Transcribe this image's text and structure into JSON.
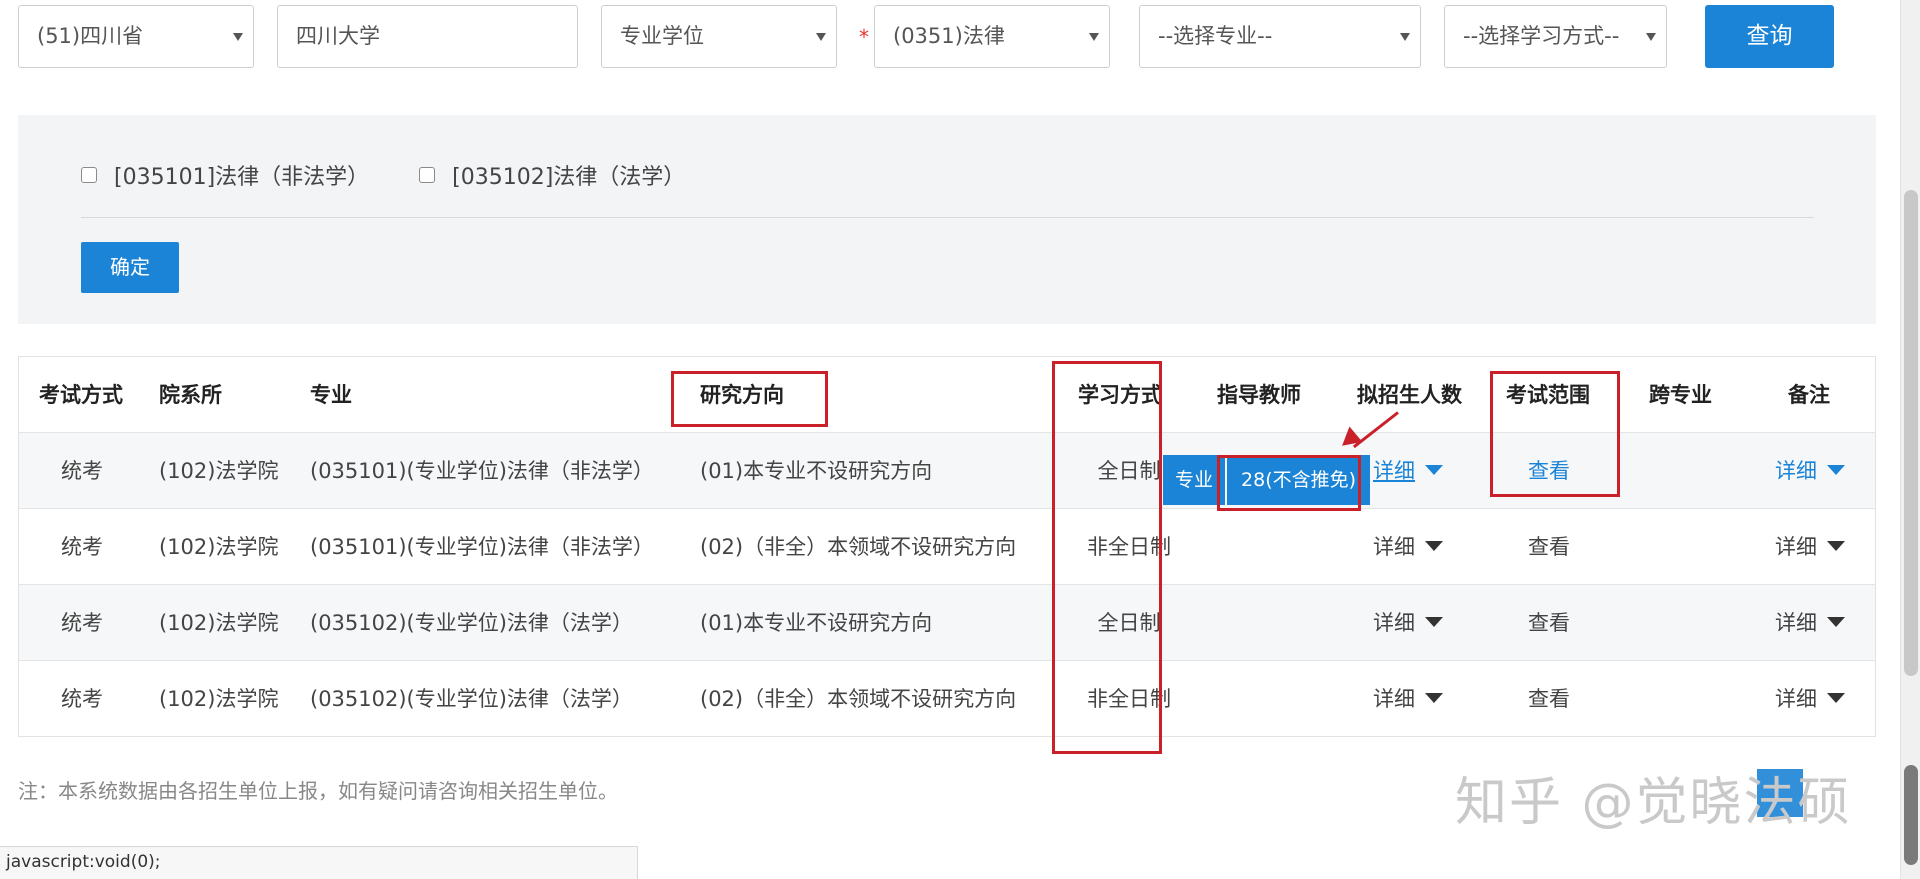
{
  "filters": {
    "province": "(51)四川省",
    "school": "四川大学",
    "degree_type": "专业学位",
    "required_mark": "*",
    "discipline": "(0351)法律",
    "major_placeholder": "--选择专业--",
    "study_mode_placeholder": "--选择学习方式--",
    "query_label": "查询"
  },
  "majors_panel": {
    "options": [
      {
        "label": "[035101]法律（非法学）",
        "checked": false
      },
      {
        "label": "[035102]法律（法学）",
        "checked": false
      }
    ],
    "confirm_label": "确定"
  },
  "table": {
    "headers": {
      "exam_type": "考试方式",
      "department": "院系所",
      "major": "专业",
      "research_direction": "研究方向",
      "study_mode": "学习方式",
      "advisor": "指导教师",
      "planned_enrollment": "拟招生人数",
      "exam_scope": "考试范围",
      "cross_major": "跨专业",
      "remarks": "备注"
    },
    "rows": [
      {
        "exam_type": "统考",
        "department": "(102)法学院",
        "major": "(035101)(专业学位)法律（非法学）",
        "research_direction": "(01)本专业不设研究方向",
        "study_mode": "全日制",
        "enrollment": "详细",
        "exam_scope": "查看",
        "remarks": "详细"
      },
      {
        "exam_type": "统考",
        "department": "(102)法学院",
        "major": "(035101)(专业学位)法律（非法学）",
        "research_direction": "(02)（非全）本领域不设研究方向",
        "study_mode": "非全日制",
        "enrollment": "详细",
        "exam_scope": "查看",
        "remarks": "详细"
      },
      {
        "exam_type": "统考",
        "department": "(102)法学院",
        "major": "(035102)(专业学位)法律（法学）",
        "research_direction": "(01)本专业不设研究方向",
        "study_mode": "全日制",
        "enrollment": "详细",
        "exam_scope": "查看",
        "remarks": "详细"
      },
      {
        "exam_type": "统考",
        "department": "(102)法学院",
        "major": "(035102)(专业学位)法律（法学）",
        "research_direction": "(02)（非全）本领域不设研究方向",
        "study_mode": "非全日制",
        "enrollment": "详细",
        "exam_scope": "查看",
        "remarks": "详细"
      }
    ]
  },
  "tooltip": {
    "label": "专业",
    "value": "28(不含推免)"
  },
  "note": "注：本系统数据由各招生单位上报，如有疑问请咨询相关招生单位。",
  "watermark": "知乎 @觉晓法硕",
  "status_bar": "javascript:void(0);",
  "colors": {
    "accent": "#1c84d6",
    "annotation_red": "#c9202a"
  }
}
